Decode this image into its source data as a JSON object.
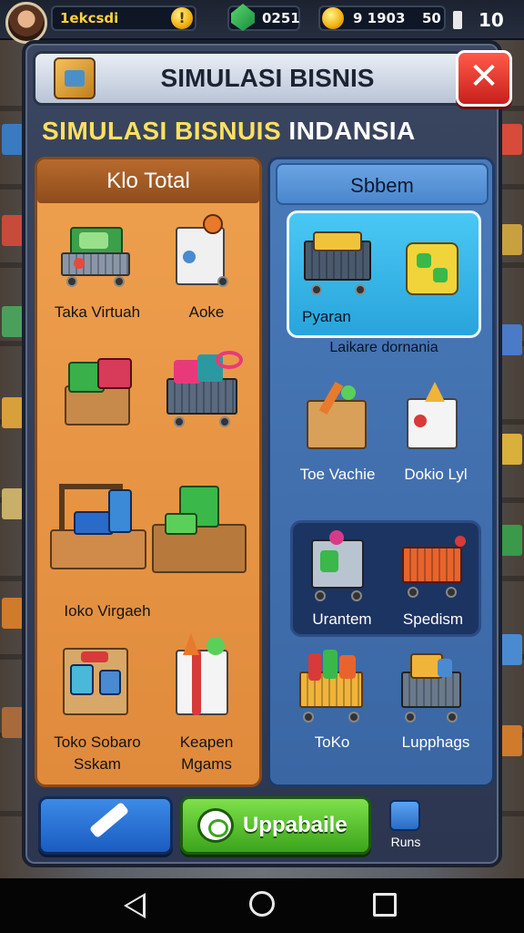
{
  "hud": {
    "player_name": "1ekcsdi",
    "alert_icon": "exclamation-coin-icon",
    "alert_glyph": "!",
    "gem_value": "0251",
    "coins_value": "9 1903",
    "tokens_value": "50",
    "level_value": "10"
  },
  "dialog": {
    "title": "SIMULASI BISNIS",
    "close_glyph": "✕",
    "subtitle_part1": "SIMULASI BISNUIS",
    "subtitle_part2": "INDANSIA"
  },
  "left_column": {
    "header": "Klo Total",
    "items": [
      {
        "label": "Taka Virtuah",
        "icon": "cart-cash-register-icon"
      },
      {
        "label": "Aoke",
        "icon": "fridge-icon"
      },
      {
        "label": "",
        "icon": "crate-with-goods-icon"
      },
      {
        "label": "",
        "icon": "shopping-cart-icon"
      },
      {
        "label": "Ioko Virgaeh",
        "icon": "market-stall-icon"
      },
      {
        "label": "",
        "icon": "green-goods-crate-icon"
      },
      {
        "label": "Toko Sobaro Sskam",
        "icon": "box-store-icon"
      },
      {
        "label": "Keapen Mgams",
        "icon": "appliance-icon"
      }
    ]
  },
  "right_column": {
    "header": "Sbbem",
    "featured_tile": {
      "label": "Pyaran",
      "caption": "Laikare dornania"
    },
    "items": [
      {
        "label": "Toe Vachie",
        "icon": "stall-box-icon"
      },
      {
        "label": "Dokio Lyl",
        "icon": "white-box-icon"
      },
      {
        "label": "Urantem",
        "icon": "machine-cart-icon"
      },
      {
        "label": "Spedism",
        "icon": "orange-cart-icon"
      },
      {
        "label": "ToKo",
        "icon": "basket-cart-icon"
      },
      {
        "label": "Lupphags",
        "icon": "grocery-cart-icon"
      }
    ]
  },
  "bottom_bar": {
    "green_button_label": "Uppabaile",
    "runs_label": "Runs"
  },
  "colors": {
    "accent_yellow": "#ffe060",
    "close_red": "#e0322a",
    "left_panel": "#e8963f",
    "right_panel": "#4272ae",
    "green_button": "#5cc234",
    "blue_button": "#2a74d4"
  }
}
